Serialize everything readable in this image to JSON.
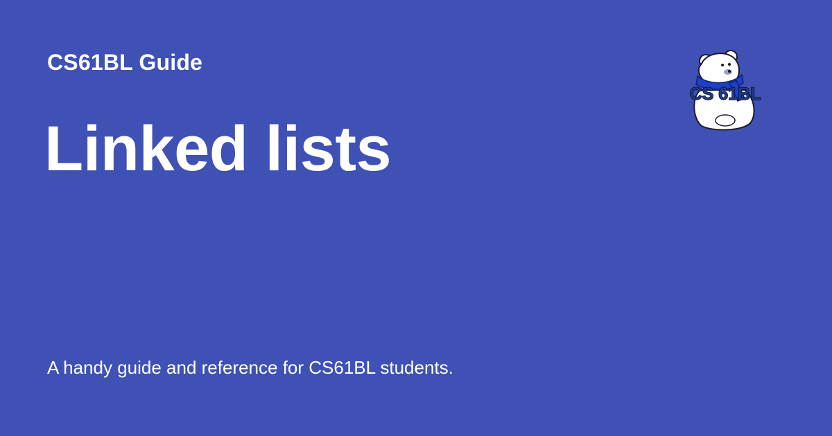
{
  "site": {
    "name": "CS61BL Guide"
  },
  "page": {
    "title": "Linked lists",
    "description": "A handy guide and reference for CS61BL students."
  },
  "logo": {
    "text": "CS 61BL"
  },
  "colors": {
    "background": "#3f51b5",
    "text": "#ffffff",
    "scarf": "#1e40c8"
  }
}
